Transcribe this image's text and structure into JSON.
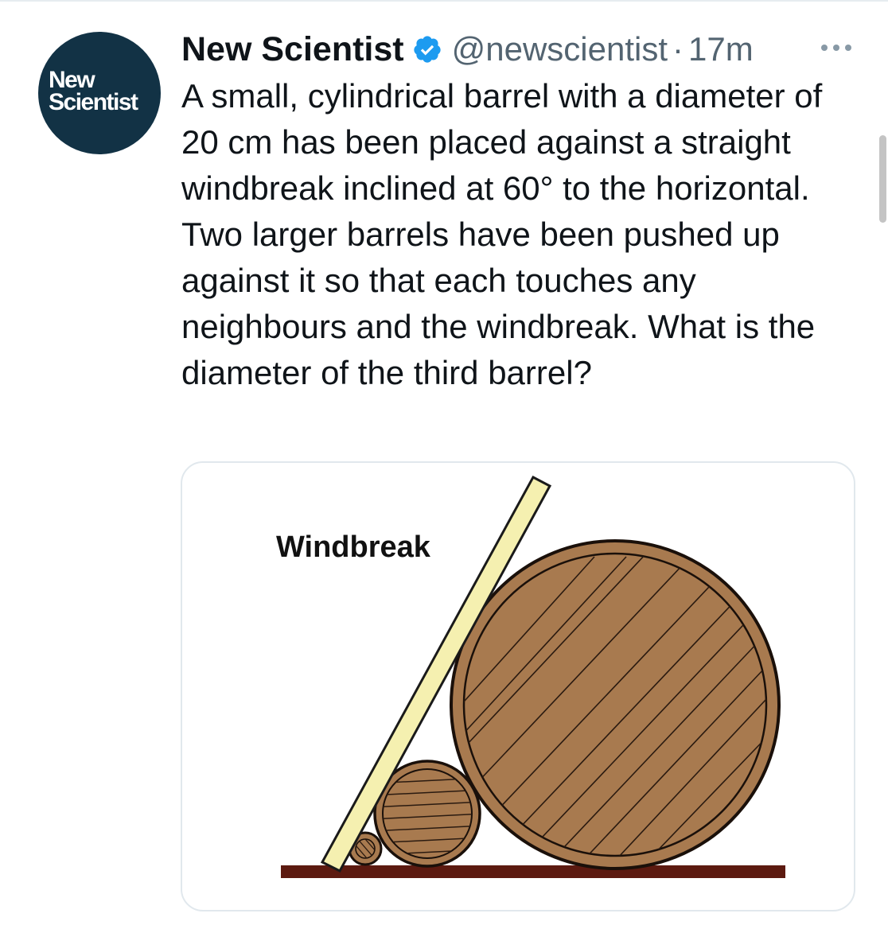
{
  "tweet": {
    "avatar": {
      "logo_line1": "New",
      "logo_line2": "Scientist",
      "background": "#123245"
    },
    "author": {
      "display_name": "New Scientist",
      "verified_icon": "verified-badge-icon",
      "handle": "@newscientist",
      "separator": "·",
      "time": "17m"
    },
    "more_icon": "more-options-icon",
    "text": "A small, cylindrical barrel with a diameter of 20 cm has been placed against a straight windbreak inclined at 60° to the horizontal. Two larger barrels have been pushed up against it so that each touches any neighbours and the windbreak. What is the diameter of the third barrel?",
    "media": {
      "label": "Windbreak",
      "colors": {
        "windbreak_fill": "#f5f0b0",
        "barrel_fill": "#a87a4f",
        "barrel_stroke": "#2a1a10",
        "ground": "#5c1a10"
      }
    }
  },
  "colors": {
    "text_primary": "#0f1419",
    "text_secondary": "#536471",
    "verified": "#1d9bf0"
  }
}
